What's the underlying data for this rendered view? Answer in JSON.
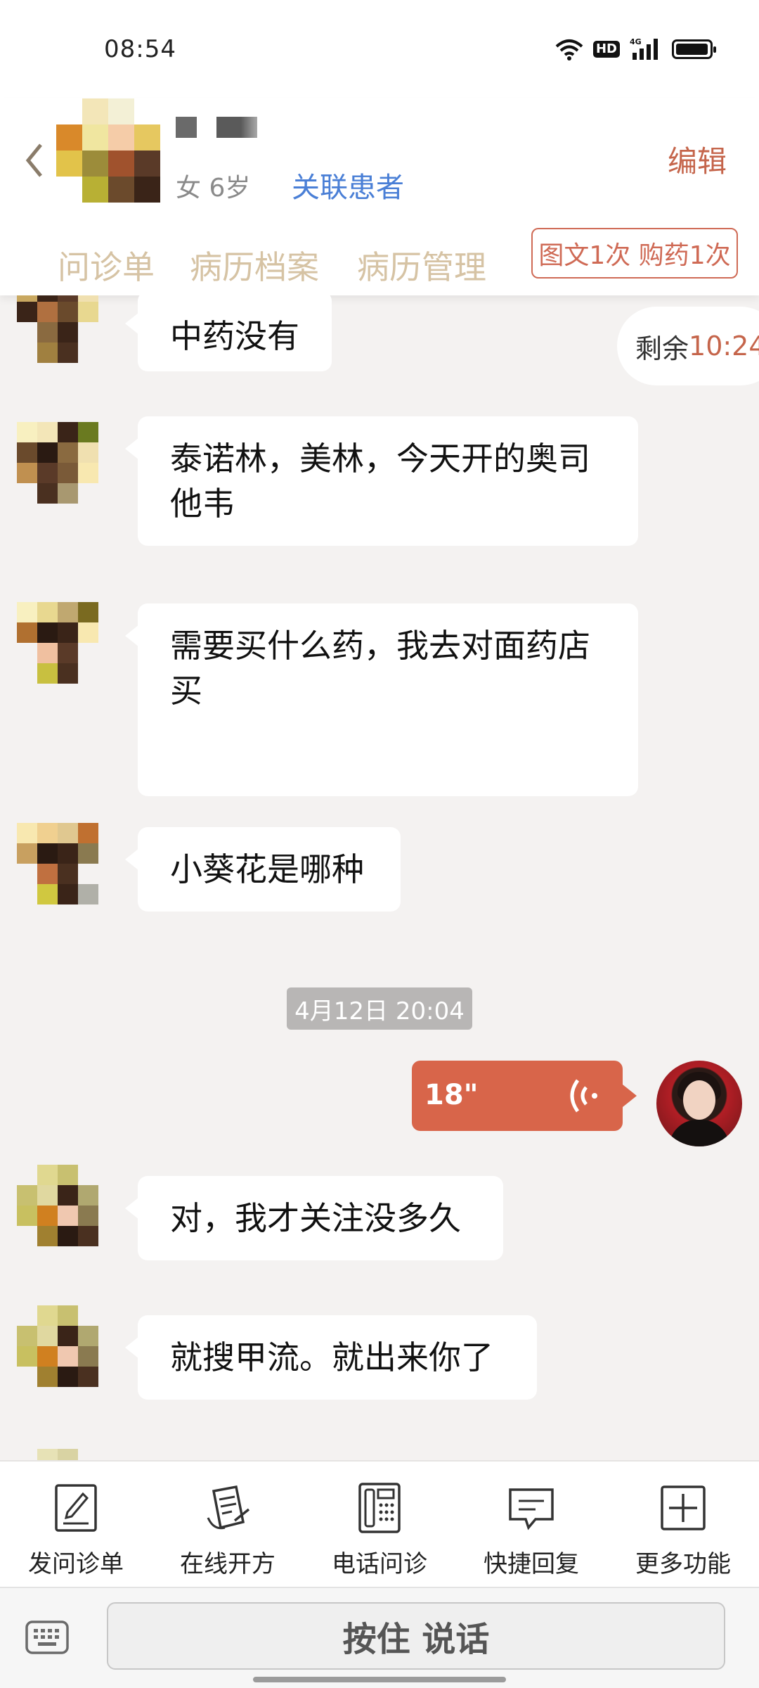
{
  "status_bar": {
    "time": "08:54",
    "hd": "HD",
    "network": "4G"
  },
  "header": {
    "patient_meta": "女 6岁",
    "link_patient": "关联患者",
    "edit": "编辑",
    "tabs": [
      "问诊单",
      "病历档案",
      "病历管理"
    ],
    "quota": "图文1次 购药1次"
  },
  "chat": {
    "remaining_label": "剩余",
    "remaining_value": "10:24",
    "messages": [
      "中药没有",
      "泰诺林，美林，今天开的奥司他韦",
      "需要买什么药，我去对面药店买",
      "小葵花是哪种",
      "对，我才关注没多久",
      "就搜甲流。就出来你了"
    ],
    "timestamp": "4月12日 20:04",
    "voice_duration": "18\""
  },
  "toolbar": {
    "items": [
      "发问诊单",
      "在线开方",
      "电话问诊",
      "快捷回复",
      "更多功能"
    ]
  },
  "input": {
    "hold_to_talk": "按住 说话"
  },
  "colors": {
    "accent": "#c5654b",
    "voice": "#d8654a",
    "link": "#4a7fd6",
    "tab": "#d6c3a4"
  }
}
